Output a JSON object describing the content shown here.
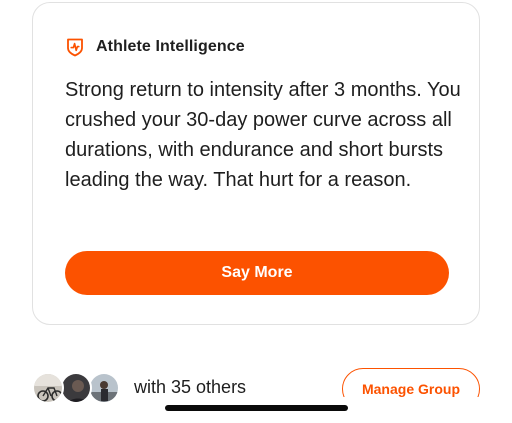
{
  "athlete_intelligence": {
    "title": "Athlete Intelligence",
    "icon": "athlete-intelligence-icon",
    "summary": "Strong return to intensity after 3 months. You crushed your 30-day power curve across all durations, with endurance and short bursts leading the way. That hurt for a reason.",
    "say_more_label": "Say More"
  },
  "group": {
    "others_text": "with 35 others",
    "manage_label": "Manage Group"
  },
  "colors": {
    "accent": "#fc5200",
    "text": "#1e1e1e",
    "card_border": "#e1e1e1"
  }
}
